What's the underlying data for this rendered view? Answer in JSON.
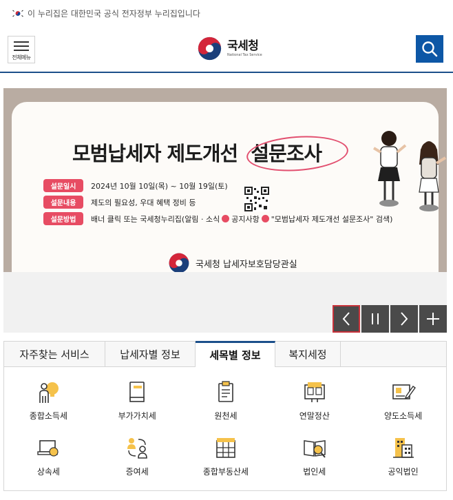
{
  "gov_notice": "이 누리집은 대한민국 공식 전자정부 누리집입니다",
  "header": {
    "menu_label": "전체메뉴",
    "logo_ko": "국세청",
    "logo_en": "National Tax Service"
  },
  "banner": {
    "title_main": "모범납세자 제도개선",
    "title_highlight": "설문조사",
    "rows": [
      {
        "tag": "설문일시",
        "text": "2024년 10월 10일(목) ~ 10월 19일(토)"
      },
      {
        "tag": "설문내용",
        "text": "제도의 필요성, 우대 혜택 정비 등"
      },
      {
        "tag": "설문방법",
        "text_1": "배너 클릭 또는 국세청누리집(알림 · 소식",
        "text_2": "공지사항",
        "text_3": "\"모범납세자 제도개선 설문조사\" 검색)"
      }
    ],
    "footer": "국세청 납세자보호담당관실",
    "accent_color": "#e74c63"
  },
  "slider_controls": [
    "prev",
    "pause",
    "next",
    "more"
  ],
  "tabs": [
    {
      "label": "자주찾는 서비스"
    },
    {
      "label": "납세자별 정보"
    },
    {
      "label": "세목별 정보"
    },
    {
      "label": "복지세정"
    }
  ],
  "active_tab": "세목별 정보",
  "services": [
    {
      "label": "종합소득세",
      "icon": "person-bulb-icon"
    },
    {
      "label": "부가가치세",
      "icon": "book-icon"
    },
    {
      "label": "원천세",
      "icon": "clipboard-icon"
    },
    {
      "label": "연말정산",
      "icon": "document-screen-icon"
    },
    {
      "label": "양도소득세",
      "icon": "document-pen-icon"
    },
    {
      "label": "상속세",
      "icon": "laptop-coin-icon"
    },
    {
      "label": "증여세",
      "icon": "people-exchange-icon"
    },
    {
      "label": "종합부동산세",
      "icon": "building-grid-icon"
    },
    {
      "label": "법인세",
      "icon": "book-search-icon"
    },
    {
      "label": "공익법인",
      "icon": "buildings-icon"
    }
  ]
}
